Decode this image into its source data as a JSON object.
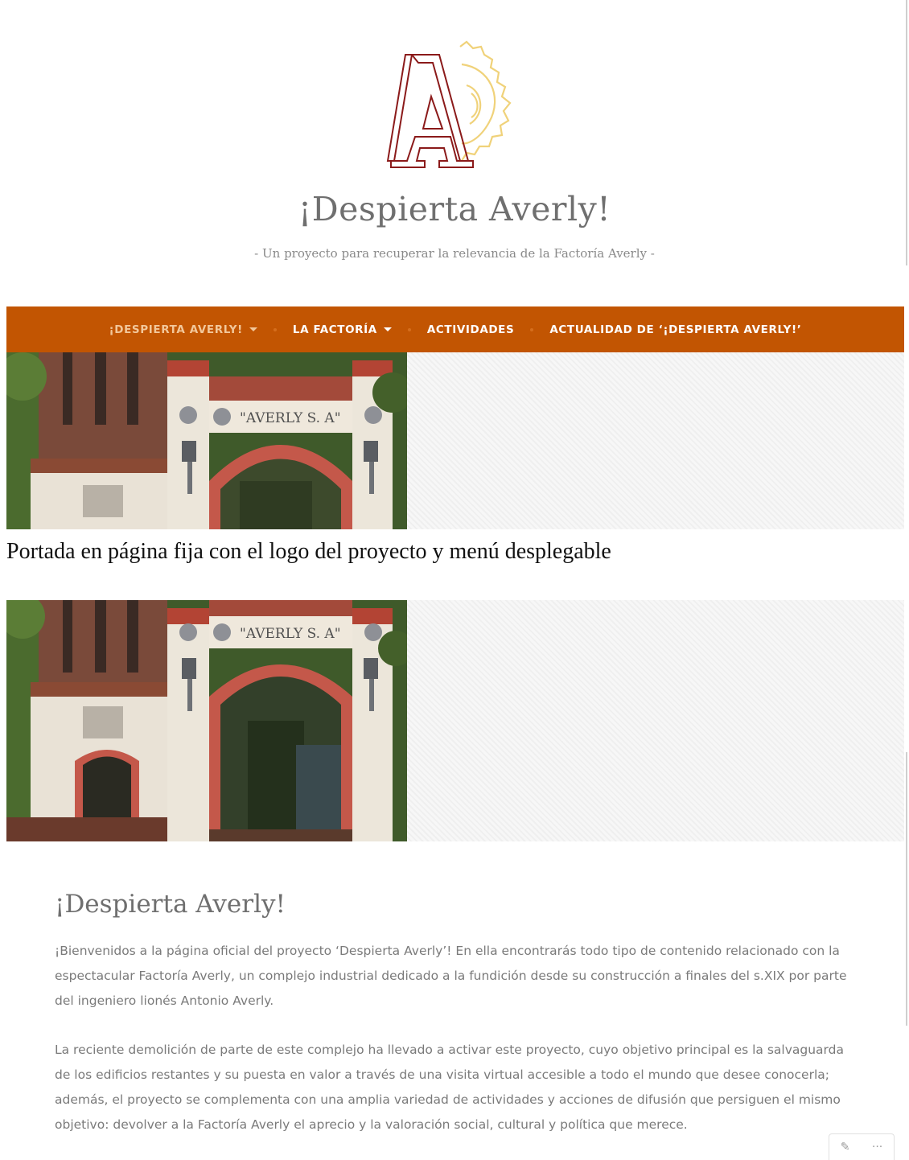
{
  "site": {
    "title": "¡Despierta Averly!",
    "tagline": "- Un proyecto para recuperar la relevancia de la Factoría Averly -",
    "logo_letter": "A"
  },
  "nav": {
    "items": [
      {
        "label": "¡DESPIERTA AVERLY!",
        "has_dropdown": true,
        "active": true
      },
      {
        "label": "LA FACTORÍA",
        "has_dropdown": true,
        "active": false
      },
      {
        "label": "ACTIVIDADES",
        "has_dropdown": false,
        "active": false
      },
      {
        "label": "ACTUALIDAD DE ‘¡DESPIERTA AVERLY!’",
        "has_dropdown": false,
        "active": false
      }
    ]
  },
  "hero": {
    "sign_text": "\"AVERLY S. A\""
  },
  "caption": "Portada en página fija con el logo del proyecto y menú desplegable",
  "content": {
    "title": "¡Despierta Averly!",
    "paragraph1": "¡Bienvenidos a la página oficial del proyecto ‘Despierta Averly’! En ella encontrarás todo tipo de contenido relacionado con la espectacular Factoría Averly, un complejo industrial dedicado a la fundición desde su construcción a finales del s.XIX por parte del ingeniero lionés Antonio Averly.",
    "paragraph2": "La reciente demolición de parte de este complejo ha llevado a activar este proyecto, cuyo objetivo principal es la salvaguarda de los edificios restantes y su puesta en valor a través de una visita virtual accesible a todo el mundo que desee conocerla; además, el proyecto se complementa con una amplia variedad de actividades y acciones de difusión que persiguen el mismo objetivo: devolver a la Factoría Averly el aprecio y la valoración social, cultural y política que merece."
  },
  "colors": {
    "nav_bg": "#c25502",
    "nav_active": "#f2c79a",
    "logo_red": "#8b1a1a",
    "logo_gold": "#f0d27a",
    "text_gray": "#7a7a7a"
  },
  "icons": [
    "pencil-icon",
    "more-icon"
  ]
}
